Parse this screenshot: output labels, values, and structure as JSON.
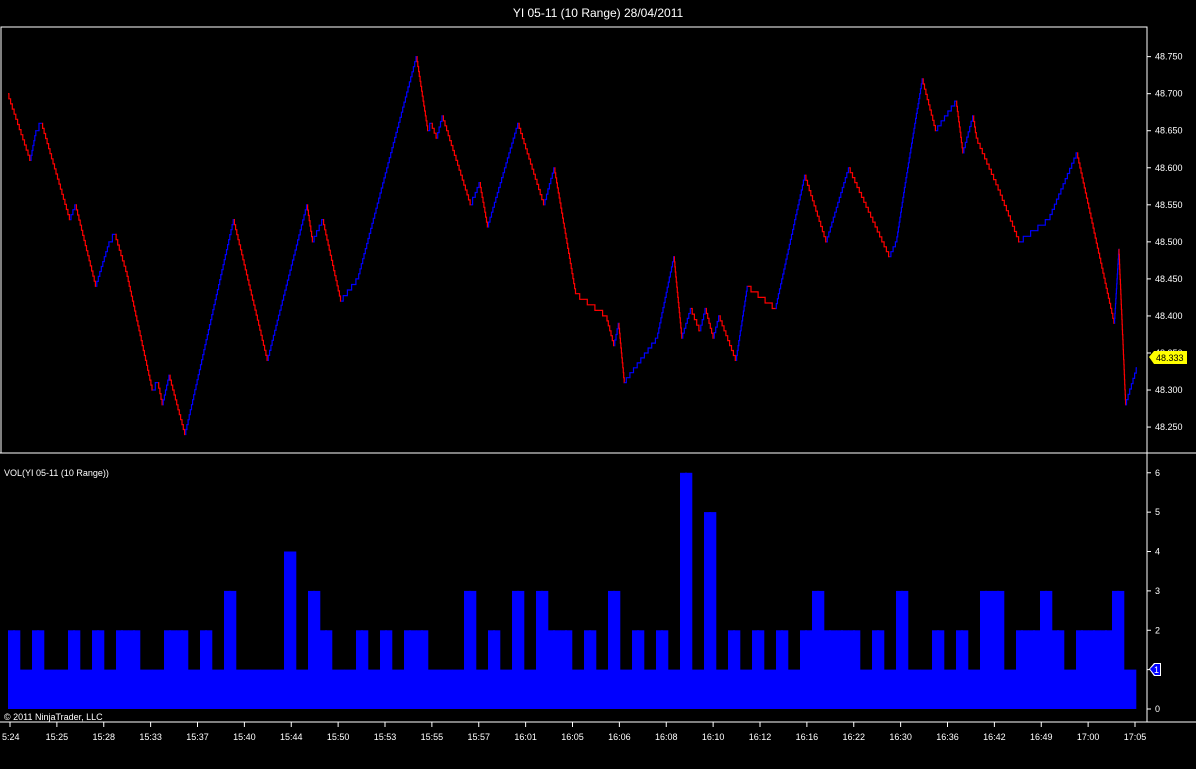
{
  "window": {
    "title": "YI 05-11 (10 Range)  28/04/2011"
  },
  "price_panel": {
    "last_price_label": "48.333"
  },
  "volume_panel": {
    "label": "VOL(YI 05-11 (10 Range))",
    "last_value_label": "1"
  },
  "copyright": "© 2011 NinjaTrader, LLC",
  "colors": {
    "background": "#000000",
    "up_bar": "#0000ff",
    "down_bar": "#ff0000",
    "volume": "#0000ff",
    "price_marker": "#ffff00",
    "axis": "#ffffff"
  },
  "chart_data": [
    {
      "type": "line",
      "series": [
        {
          "x": [
            0,
            0.02,
            0.025,
            0.03,
            0.055,
            0.06,
            0.078,
            0.09,
            0.095,
            0.105,
            0.128,
            0.133,
            0.137,
            0.143,
            0.157,
            0.16,
            0.2,
            0.23,
            0.265,
            0.27,
            0.279,
            0.295,
            0.31,
            0.362,
            0.372,
            0.375,
            0.38,
            0.385,
            0.41,
            0.413,
            0.418,
            0.425,
            0.452,
            0.475,
            0.484,
            0.503,
            0.53,
            0.537,
            0.541,
            0.546,
            0.575,
            0.59,
            0.597,
            0.605,
            0.613,
            0.618,
            0.625,
            0.63,
            0.645,
            0.655,
            0.68,
            0.706,
            0.725,
            0.745,
            0.781,
            0.787,
            0.795,
            0.81,
            0.822,
            0.84,
            0.846,
            0.855,
            0.858,
            0.878,
            0.896,
            0.922,
            0.947,
            0.98,
            0.984,
            0.99,
            1.0
          ],
          "y": [
            48.7,
            48.61,
            48.65,
            48.66,
            48.53,
            48.55,
            48.44,
            48.5,
            48.51,
            48.46,
            48.3,
            48.31,
            48.28,
            48.32,
            48.24,
            48.26,
            48.53,
            48.34,
            48.55,
            48.5,
            48.53,
            48.42,
            48.45,
            48.75,
            48.65,
            48.66,
            48.64,
            48.67,
            48.55,
            48.56,
            48.58,
            48.52,
            48.66,
            48.55,
            48.6,
            48.43,
            48.4,
            48.36,
            48.39,
            48.31,
            48.37,
            48.48,
            48.37,
            48.41,
            48.38,
            48.41,
            48.37,
            48.4,
            48.34,
            48.44,
            48.41,
            48.59,
            48.5,
            48.6,
            48.48,
            48.5,
            48.58,
            48.72,
            48.65,
            48.69,
            48.62,
            48.67,
            48.64,
            48.57,
            48.5,
            48.53,
            48.62,
            48.39,
            48.49,
            48.28,
            48.33
          ]
        }
      ],
      "x_tick_labels": [
        "5:24",
        "15:25",
        "15:28",
        "15:33",
        "15:37",
        "15:40",
        "15:44",
        "15:50",
        "15:53",
        "15:55",
        "15:57",
        "16:01",
        "16:05",
        "16:06",
        "16:08",
        "16:10",
        "16:12",
        "16:16",
        "16:22",
        "16:30",
        "16:36",
        "16:42",
        "16:49",
        "17:00",
        "17:05"
      ],
      "y_tick_labels": [
        "48.750",
        "48.700",
        "48.650",
        "48.600",
        "48.550",
        "48.500",
        "48.450",
        "48.400",
        "48.350",
        "48.300",
        "48.250"
      ],
      "ylim": [
        48.215,
        48.79
      ]
    },
    {
      "type": "bar",
      "values": [
        2,
        1,
        2,
        1,
        1,
        2,
        1,
        2,
        1,
        2,
        2,
        1,
        1,
        2,
        2,
        1,
        2,
        1,
        3,
        1,
        1,
        1,
        1,
        4,
        1,
        3,
        2,
        1,
        1,
        2,
        1,
        2,
        1,
        2,
        2,
        1,
        1,
        1,
        3,
        1,
        2,
        1,
        3,
        1,
        3,
        2,
        2,
        1,
        2,
        1,
        3,
        1,
        2,
        1,
        2,
        1,
        6,
        1,
        5,
        1,
        2,
        1,
        2,
        1,
        2,
        1,
        2,
        3,
        2,
        2,
        2,
        1,
        2,
        1,
        3,
        1,
        1,
        2,
        1,
        2,
        1,
        3,
        3,
        1,
        2,
        2,
        3,
        2,
        1,
        2,
        2,
        2,
        3,
        1
      ],
      "y_tick_labels": [
        "6",
        "5",
        "4",
        "3",
        "2",
        "1",
        "0"
      ],
      "ylim": [
        0,
        6.35
      ]
    }
  ]
}
